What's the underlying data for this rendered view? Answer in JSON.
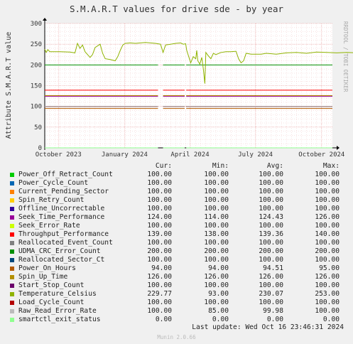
{
  "title": "S.M.A.R.T values for drive sde - by year",
  "side_text": "RRDTOOL / TOBI OETIKER",
  "footer_version": "Munin 2.0.66",
  "last_update": "Last update: Wed Oct 16 23:46:31 2024",
  "legend_header": {
    "cur": "Cur:",
    "min": "Min:",
    "avg": "Avg:",
    "max": "Max:"
  },
  "colors": {
    "background": "#f0f0f0",
    "plot": "#ffffff",
    "grid_major": "#e8a0a0",
    "grid_minor": "#f0c8c8"
  },
  "chart_data": {
    "type": "line",
    "ylabel": "Attribute S.M.A.R.T value",
    "ylim": [
      0,
      300
    ],
    "y_ticks": [
      0,
      50,
      100,
      150,
      200,
      250,
      300
    ],
    "x_ticks": [
      "October 2023",
      "January 2024",
      "April 2024",
      "July 2024",
      "October 2024"
    ],
    "x_range": [
      "2023-09-12",
      "2024-10-16"
    ],
    "grid": true,
    "series": [
      {
        "name": "Power_Off_Retract_Count",
        "color": "#00cc00",
        "cur": "100.00",
        "min": "100.00",
        "avg": "100.00",
        "max": "100.00",
        "flat": 100
      },
      {
        "name": "Power_Cycle_Count",
        "color": "#0066b3",
        "cur": "100.00",
        "min": "100.00",
        "avg": "100.00",
        "max": "100.00",
        "flat": 100
      },
      {
        "name": "Current_Pending_Sector",
        "color": "#ff8000",
        "cur": "100.00",
        "min": "100.00",
        "avg": "100.00",
        "max": "100.00",
        "flat": 100
      },
      {
        "name": "Spin_Retry_Count",
        "color": "#ffcc00",
        "cur": "100.00",
        "min": "100.00",
        "avg": "100.00",
        "max": "100.00",
        "flat": 100
      },
      {
        "name": "Offline_Uncorrectable",
        "color": "#330099",
        "cur": "100.00",
        "min": "100.00",
        "avg": "100.00",
        "max": "100.00",
        "flat": 100
      },
      {
        "name": "Seek_Time_Performance",
        "color": "#990099",
        "cur": "124.00",
        "min": "114.00",
        "avg": "124.43",
        "max": "126.00",
        "flat": 124
      },
      {
        "name": "Seek_Error_Rate",
        "color": "#ccff00",
        "cur": "100.00",
        "min": "100.00",
        "avg": "100.00",
        "max": "100.00",
        "flat": 100
      },
      {
        "name": "Throughput_Performance",
        "color": "#ff0000",
        "cur": "139.00",
        "min": "138.00",
        "avg": "139.36",
        "max": "140.00",
        "flat": 139
      },
      {
        "name": "Reallocated_Event_Count",
        "color": "#808080",
        "cur": "100.00",
        "min": "100.00",
        "avg": "100.00",
        "max": "100.00",
        "flat": 100
      },
      {
        "name": "UDMA_CRC_Error_Count",
        "color": "#008f00",
        "cur": "200.00",
        "min": "200.00",
        "avg": "200.00",
        "max": "200.00",
        "flat": 200
      },
      {
        "name": "Reallocated_Sector_Ct",
        "color": "#00487d",
        "cur": "100.00",
        "min": "100.00",
        "avg": "100.00",
        "max": "100.00",
        "flat": 100
      },
      {
        "name": "Power_On_Hours",
        "color": "#b35a00",
        "cur": "94.00",
        "min": "94.00",
        "avg": "94.51",
        "max": "95.00",
        "flat": 95
      },
      {
        "name": "Spin_Up_Time",
        "color": "#b38f00",
        "cur": "126.00",
        "min": "126.00",
        "avg": "126.00",
        "max": "126.00",
        "flat": 126
      },
      {
        "name": "Start_Stop_Count",
        "color": "#6b006b",
        "cur": "100.00",
        "min": "100.00",
        "avg": "100.00",
        "max": "100.00",
        "flat": 100
      },
      {
        "name": "Temperature_Celsius",
        "color": "#8fb300",
        "cur": "229.77",
        "min": "93.00",
        "avg": "230.07",
        "max": "253.00",
        "points": [
          [
            0,
            238
          ],
          [
            0.3,
            230
          ],
          [
            0.6,
            237
          ],
          [
            1,
            232
          ],
          [
            3,
            232
          ],
          [
            5,
            231
          ],
          [
            6,
            229
          ],
          [
            6.5,
            252
          ],
          [
            7,
            240
          ],
          [
            7.5,
            248
          ],
          [
            8,
            232
          ],
          [
            9,
            218
          ],
          [
            9.5,
            225
          ],
          [
            10,
            242
          ],
          [
            11,
            250
          ],
          [
            11.5,
            228
          ],
          [
            12,
            215
          ],
          [
            13,
            213
          ],
          [
            14,
            210
          ],
          [
            14.5,
            220
          ],
          [
            15,
            235
          ],
          [
            15.5,
            248
          ],
          [
            16,
            252
          ],
          [
            17,
            253
          ],
          [
            18,
            252
          ],
          [
            19,
            253
          ],
          [
            20,
            254
          ],
          [
            21,
            253
          ],
          [
            22,
            252
          ],
          [
            23,
            250
          ],
          [
            23.5,
            230
          ],
          [
            24,
            248
          ],
          [
            25,
            250
          ],
          [
            26,
            252
          ],
          [
            27,
            253
          ],
          [
            27.5,
            250
          ],
          [
            28,
            251
          ],
          [
            28.2,
            235
          ],
          [
            29,
            205
          ],
          [
            29.5,
            220
          ],
          [
            30,
            215
          ],
          [
            30.2,
            235
          ],
          [
            30.4,
            210
          ],
          [
            30.8,
            202
          ],
          [
            31.2,
            218
          ],
          [
            31.5,
            190
          ],
          [
            31.8,
            155
          ],
          [
            32,
            230
          ],
          [
            32.5,
            222
          ],
          [
            33,
            215
          ],
          [
            33.5,
            228
          ],
          [
            34,
            225
          ],
          [
            35,
            230
          ],
          [
            36,
            232
          ],
          [
            37,
            232
          ],
          [
            38,
            233
          ],
          [
            38.5,
            215
          ],
          [
            39,
            205
          ],
          [
            39.5,
            210
          ],
          [
            40,
            228
          ],
          [
            41,
            226
          ],
          [
            43,
            226
          ],
          [
            44,
            228
          ],
          [
            46,
            226
          ],
          [
            48,
            229
          ],
          [
            50,
            230
          ],
          [
            52,
            228
          ],
          [
            54,
            231
          ],
          [
            56,
            230
          ],
          [
            58,
            229
          ],
          [
            60,
            230
          ],
          [
            62,
            229
          ],
          [
            64,
            231
          ],
          [
            66,
            230
          ],
          [
            68,
            229
          ],
          [
            69,
            230
          ]
        ]
      },
      {
        "name": "Load_Cycle_Count",
        "color": "#b30000",
        "cur": "100.00",
        "min": "100.00",
        "avg": "100.00",
        "max": "100.00",
        "flat": 100
      },
      {
        "name": "Raw_Read_Error_Rate",
        "color": "#bbbbbb",
        "cur": "100.00",
        "min": "85.00",
        "avg": "99.98",
        "max": "100.00",
        "flat": 100
      },
      {
        "name": "smartctl_exit_status",
        "color": "#8fff8f",
        "cur": "0.00",
        "min": "0.00",
        "avg": "0.00",
        "max": "0.00",
        "flat": 0
      }
    ]
  }
}
